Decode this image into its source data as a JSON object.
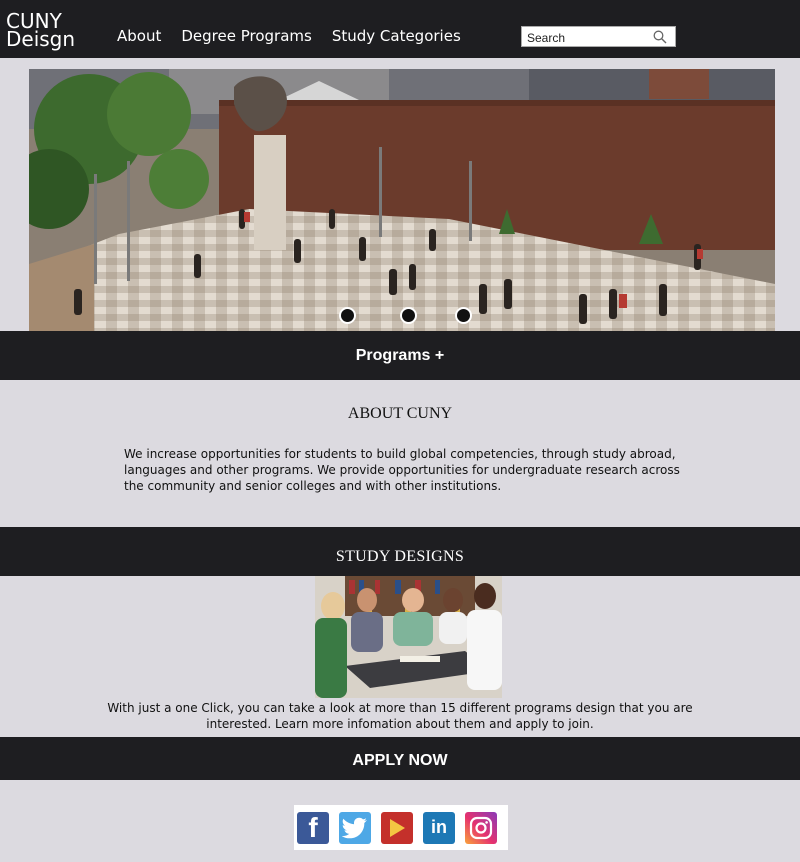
{
  "header": {
    "logo_line1": "CUNY",
    "logo_line2": "Deisgn",
    "nav": [
      "About",
      "Degree Programs",
      "Study Categories"
    ],
    "search_placeholder": "Search"
  },
  "hero": {
    "slide_count": 3,
    "active_slide": 0
  },
  "programs_bar": {
    "label": "Programs +"
  },
  "about": {
    "title": "ABOUT CUNY",
    "text": "We increase opportunities for students to build global competencies, through study abroad, languages and other programs. We provide opportunities for undergraduate research across the community and senior colleges and with other institutions."
  },
  "study": {
    "title": "STUDY DESIGNS",
    "text": "With just a one Click, you can take a look at more than 15 different programs design that you are interested. Learn more infomation about them and apply to join."
  },
  "apply": {
    "label": "APPLY NOW"
  },
  "social": {
    "icons": [
      "facebook-icon",
      "twitter-icon",
      "youtube-icon",
      "linkedin-icon",
      "instagram-icon"
    ],
    "linkedin_text": "in",
    "facebook_text": "f"
  },
  "colors": {
    "dark_bar": "#1e1e21",
    "page_bg": "#dcdae0"
  }
}
